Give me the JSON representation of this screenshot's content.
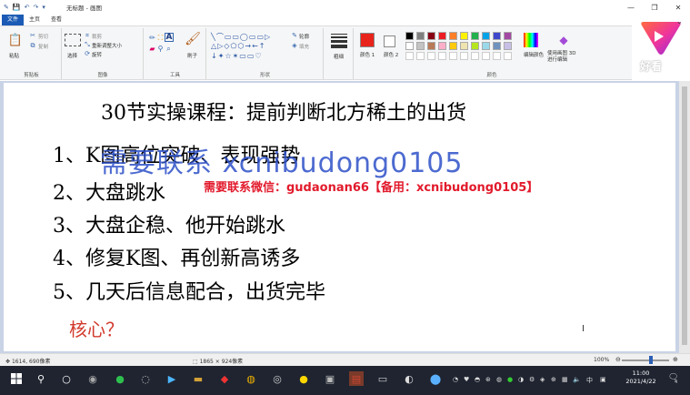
{
  "window": {
    "title": "无标题 - 画图",
    "controls": {
      "minimize": "—",
      "restore": "❐",
      "close": "✕",
      "ribbon_toggle": "⌄"
    }
  },
  "quick_access": [
    "save-icon",
    "undo-icon",
    "redo-icon"
  ],
  "tabs": [
    {
      "label": "文件",
      "active": true
    },
    {
      "label": "主页"
    },
    {
      "label": "查看"
    }
  ],
  "ribbon": {
    "clipboard": {
      "label": "剪贴板",
      "paste": "粘贴",
      "cut": "剪切",
      "copy": "复制"
    },
    "image": {
      "label": "图像",
      "select": "选择",
      "crop": "裁剪",
      "resize": "重新调整大小",
      "rotate": "旋转"
    },
    "tools": {
      "label": "工具",
      "brushes": "刷子"
    },
    "shapes": {
      "label": "形状",
      "outline": "轮廓",
      "fill": "填充"
    },
    "size": {
      "label": "粗细"
    },
    "colors": {
      "label": "颜色",
      "color1": "颜色 1",
      "color2": "颜色 2",
      "edit": "编辑颜色",
      "paint3d": "使用画图 3D 进行编辑",
      "color1_value": "#e8231b",
      "color2_value": "#ffffff",
      "palette_row1": [
        "#000000",
        "#7f7f7f",
        "#880015",
        "#ed1c24",
        "#ff7f27",
        "#fff200",
        "#22b14c",
        "#00a2e8",
        "#3f48cc",
        "#a349a4"
      ],
      "palette_row2": [
        "#ffffff",
        "#c3c3c3",
        "#b97a57",
        "#ffaec9",
        "#ffc90e",
        "#efe4b0",
        "#b5e61d",
        "#99d9ea",
        "#7092be",
        "#c8bfe7"
      ]
    }
  },
  "logo": {
    "text": "好看"
  },
  "canvas": {
    "title": "30节实操课程：提前判断北方稀土的出货",
    "items": [
      "1、K图高位突破、表现强势",
      "2、大盘跳水",
      "3、大盘企稳、他开始跳水",
      "4、修复K图、再创新高诱多",
      "5、几天后信息配合，出货完毕"
    ],
    "core": "核心？",
    "cursor": "I",
    "watermark_blue": "需要联系 xcnibudong0105",
    "watermark_red": "需要联系微信：gudaonan66【备用：xcnibudong0105】"
  },
  "status": {
    "cursor_pos": "1614, 690像素",
    "canvas_size": "1865 × 924像素",
    "zoom": "100%",
    "zoom_level_percent": 100
  },
  "taskbar": {
    "clock_time": "11:00",
    "clock_date": "2021/4/22",
    "ime": "中",
    "notif_count": "4"
  }
}
